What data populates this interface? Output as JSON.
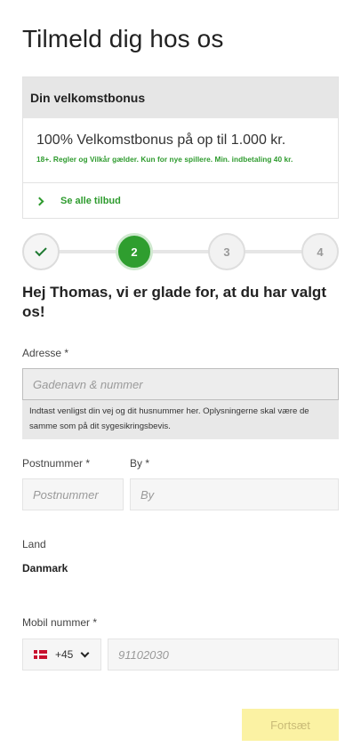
{
  "page": {
    "title": "Tilmeld dig hos os"
  },
  "bonus": {
    "header": "Din velkomstbonus",
    "offer": "100% Velkomstbonus på op til 1.000 kr.",
    "terms": "18+. Regler og Vilkår gælder. Kun for nye spillere. Min. indbetaling 40 kr.",
    "link_label": "Se alle tilbud"
  },
  "stepper": {
    "steps": [
      {
        "label": "",
        "state": "done"
      },
      {
        "label": "2",
        "state": "active"
      },
      {
        "label": "3",
        "state": "pending"
      },
      {
        "label": "4",
        "state": "pending"
      }
    ]
  },
  "greeting": "Hej Thomas, vi er glade for, at du har valgt os!",
  "form": {
    "address": {
      "label": "Adresse *",
      "placeholder": "Gadenavn & nummer",
      "value": "",
      "hint": "Indtast venligst din vej og dit husnummer her. Oplysningerne skal være de samme som på dit sygesikringsbevis."
    },
    "postal": {
      "label": "Postnummer *",
      "placeholder": "Postnummer",
      "value": ""
    },
    "city": {
      "label": "By *",
      "placeholder": "By",
      "value": ""
    },
    "country": {
      "label": "Land",
      "value": "Danmark"
    },
    "mobile": {
      "label": "Mobil nummer *",
      "country_code": "+45",
      "flag": "denmark-flag",
      "placeholder": "91102030",
      "value": ""
    },
    "submit_label": "Fortsæt"
  },
  "colors": {
    "accent_green": "#2f9e2f",
    "submit_disabled_bg": "#fbf2a3",
    "submit_disabled_text": "#c9bb77"
  }
}
